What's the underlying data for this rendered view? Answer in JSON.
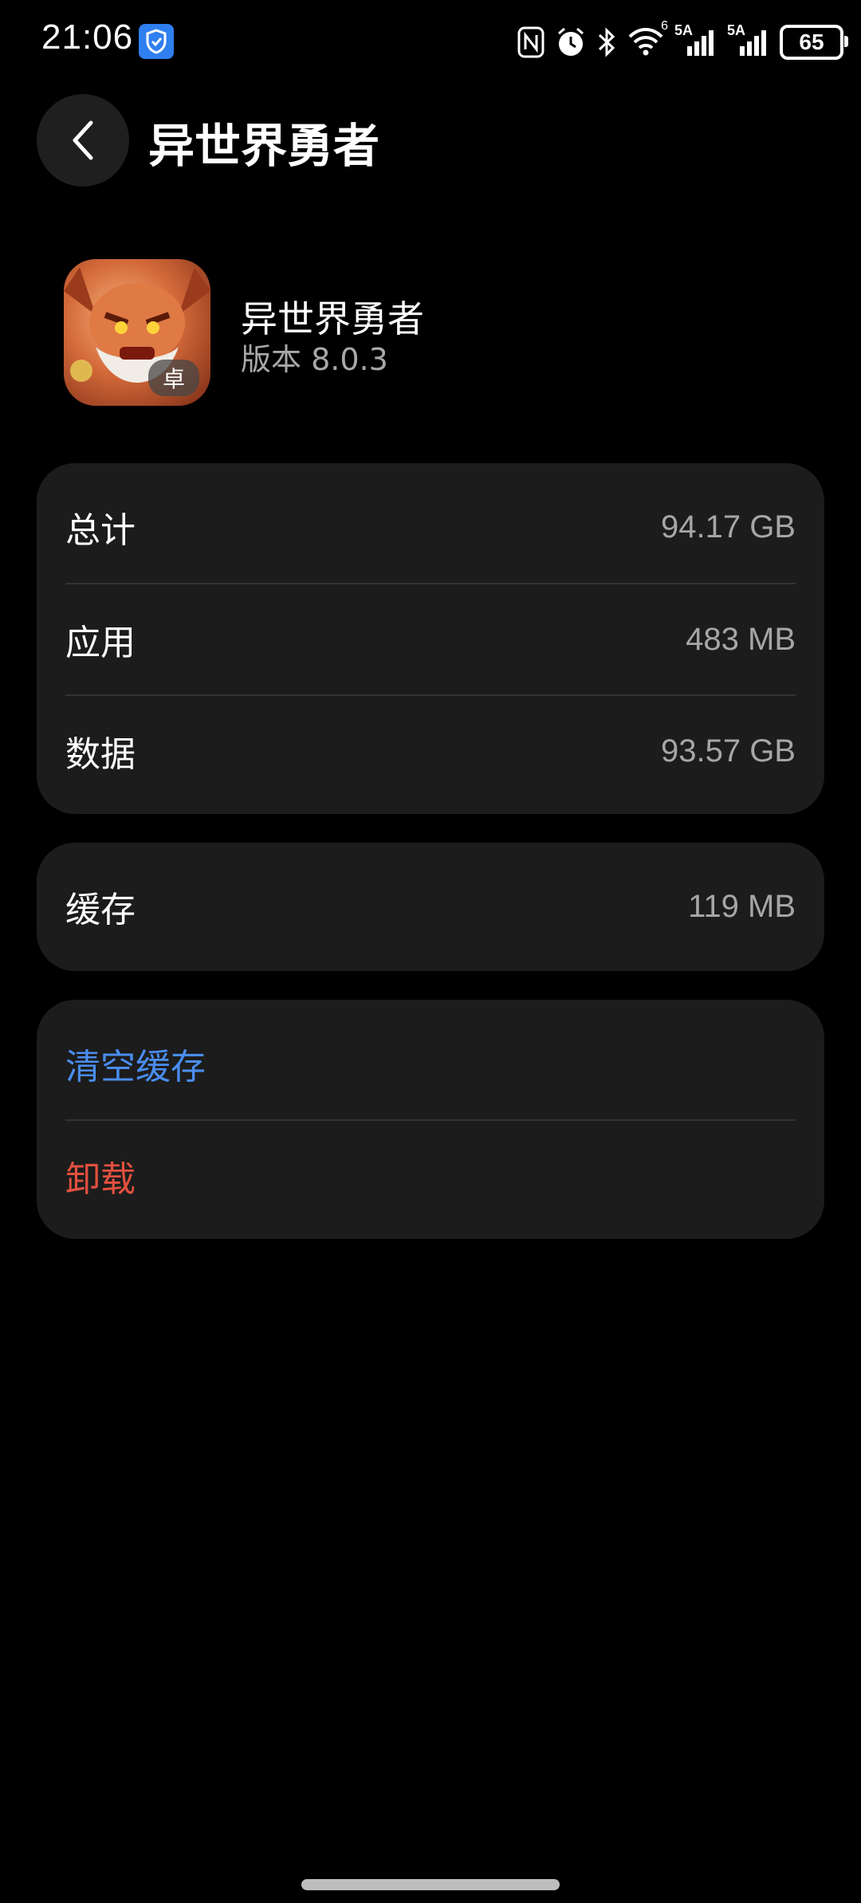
{
  "status_bar": {
    "time": "21:06",
    "battery": "65",
    "network_1": "5A",
    "network_2": "5A",
    "wifi_badge": "6",
    "icons": [
      "nfc-icon",
      "alarm-icon",
      "bluetooth-icon",
      "wifi-icon",
      "signal-icon",
      "signal-icon",
      "battery-icon"
    ]
  },
  "header": {
    "title": "异世界勇者"
  },
  "app": {
    "name": "异世界勇者",
    "version": "版本 8.0.3",
    "badge": "卓"
  },
  "storage": {
    "rows": [
      {
        "label": "总计",
        "value": "94.17 GB"
      },
      {
        "label": "应用",
        "value": "483 MB"
      },
      {
        "label": "数据",
        "value": "93.57 GB"
      }
    ]
  },
  "cache": {
    "label": "缓存",
    "value": "119 MB"
  },
  "actions": {
    "clear_cache": "清空缓存",
    "uninstall": "卸载"
  },
  "colors": {
    "background": "#000000",
    "card": "#1c1c1c",
    "accent_blue": "#4a8df0",
    "danger_red": "#e2503f",
    "secondary_text": "#a6a6a6"
  }
}
